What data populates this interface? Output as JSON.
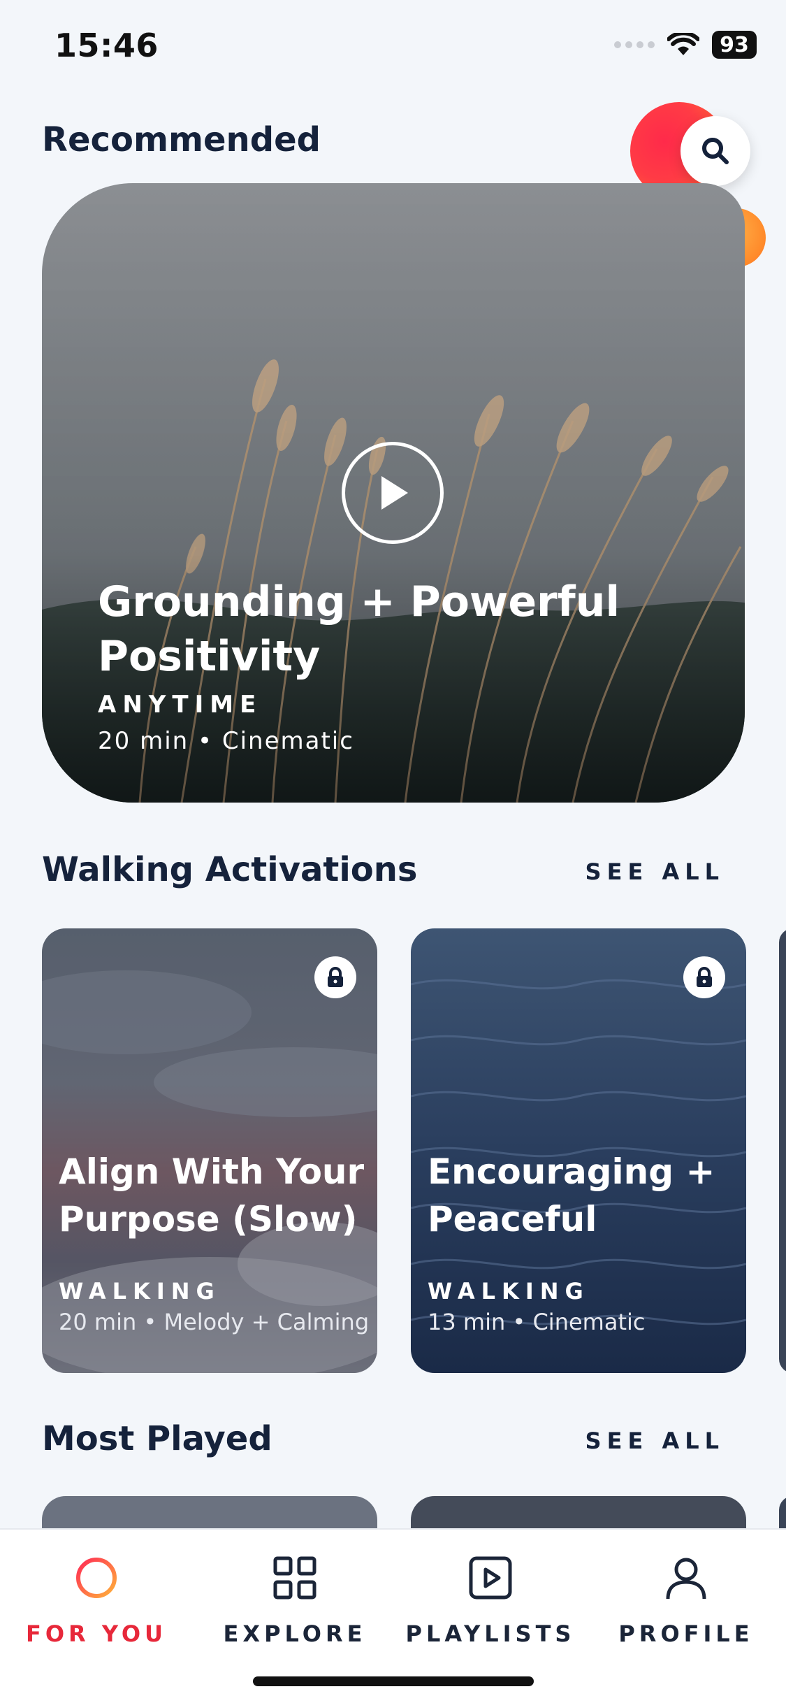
{
  "status_bar": {
    "time": "15:46",
    "battery": "93"
  },
  "recommended": {
    "title": "Recommended",
    "hero": {
      "title": "Grounding + Powerful Positivity",
      "category": "ANYTIME",
      "meta": "20 min  •  Cinematic"
    }
  },
  "walking": {
    "title": "Walking Activations",
    "see_all": "SEE ALL",
    "cards": [
      {
        "title": "Align With Your Purpose (Slow)",
        "category": "WALKING",
        "meta": "20 min • Melody + Calming"
      },
      {
        "title": "Encouraging + Peaceful",
        "category": "WALKING",
        "meta": "13 min • Cinematic"
      }
    ]
  },
  "most_played": {
    "title": "Most Played",
    "see_all": "SEE ALL"
  },
  "nav": {
    "items": [
      {
        "label": "FOR YOU",
        "icon": "ring-icon",
        "active": true
      },
      {
        "label": "EXPLORE",
        "icon": "grid-icon",
        "active": false
      },
      {
        "label": "PLAYLISTS",
        "icon": "play-square-icon",
        "active": false
      },
      {
        "label": "PROFILE",
        "icon": "person-icon",
        "active": false
      }
    ]
  },
  "colors": {
    "accent": "#e7283a",
    "text": "#15223b",
    "background": "#f3f6fa"
  }
}
